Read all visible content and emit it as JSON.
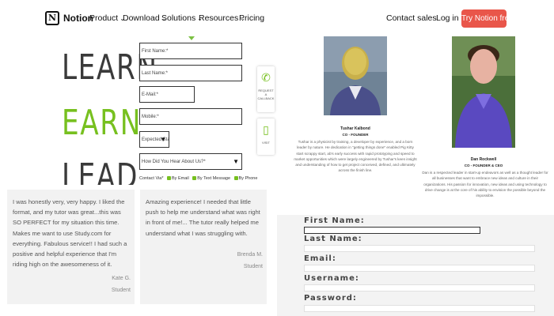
{
  "header": {
    "brand": "Notion",
    "nav": [
      {
        "label": "Product",
        "chevron": true
      },
      {
        "label": "Download",
        "chevron": true
      },
      {
        "label": "Solutions",
        "chevron": true
      },
      {
        "label": "Resources",
        "chevron": true
      },
      {
        "label": "Pricing",
        "chevron": false
      }
    ],
    "contact_sales": "Contact sales",
    "login": "Log in",
    "cta": "Try Notion free",
    "cta_color": "#e9564a"
  },
  "hero": {
    "words": [
      "LEARN",
      "EARN",
      "LEAD"
    ],
    "accent_color": "#77c01f"
  },
  "form": {
    "first_name": "First Name:*",
    "last_name": "Last Name:*",
    "email": "E-Mail:*",
    "mobile": "Mobile:*",
    "expected_start": "Expected Start:*",
    "heard_about": "How Did You Hear About Us?*",
    "contact_prefix": "Contact Via*",
    "contact_options": [
      "By Email",
      "By Text Message",
      "By Phone"
    ]
  },
  "side": {
    "call_label": "REQUEST A CALLBACK",
    "chat_label": "VISIT"
  },
  "testimonials": [
    {
      "quote": "I was honestly very, very happy. I liked the format, and my tutor was great...this was SO PERFECT for my situation this time. Makes me want to use Study.com for everything. Fabulous service!! I had such a positive and helpful experience that I'm riding high on the awesomeness of it.",
      "name": "Kate G.",
      "role": "Student"
    },
    {
      "quote": "Amazing experience! I needed that little push to help me understand what was right in front of me!... The tutor really helped me understand what I was struggling with.",
      "name": "Brenda M.",
      "role": "Student"
    }
  ],
  "team": [
    {
      "name": "Tushar Kalbond",
      "role": "CO - FOUNDER",
      "bio": "Tushar is a physicist by training, a developer by experience, and a born leader by nature. He dedication in \"getting things done\" enabled Pig Kitty start scrappy start, ab's early success with rapid prototyping and speed to market opportunities which were largely engineered by Tushar's keen insight and understanding of how to get project conceived, defined, and ultimately across the finish line."
    },
    {
      "name": "Dan Rockwell",
      "role": "CO - FOUNDER & CEO",
      "bio": "Dan is a respected leader in start-up endeavors as well as a thought leader for all businesses that want to embrace new ideas and culture in their organizations. His passion for innovation, new ideas and using technology to drive change is at the core of his ability to envision the possible beyond the impossible."
    }
  ],
  "signup": {
    "labels": [
      "First Name:",
      "Last Name:",
      "Email:",
      "Username:",
      "Password:"
    ]
  }
}
